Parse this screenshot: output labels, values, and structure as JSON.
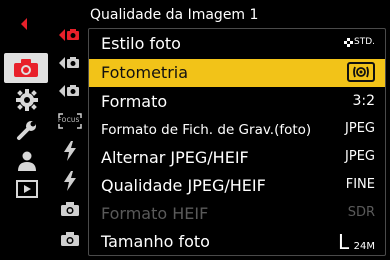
{
  "header": {
    "title": "Qualidade da Imagem 1"
  },
  "categories": [
    {
      "icon": "tab-marker-icon"
    },
    {
      "icon": "camera-icon",
      "active": true
    },
    {
      "icon": "gear-icon"
    },
    {
      "icon": "wrench-icon"
    },
    {
      "icon": "person-icon"
    },
    {
      "icon": "playback-icon"
    }
  ],
  "tabs": [
    {
      "icon": "photo-tab-1-icon",
      "active": true
    },
    {
      "icon": "photo-tab-2-icon"
    },
    {
      "icon": "photo-tab-3-icon"
    },
    {
      "icon": "focus-tab-icon",
      "text": "FOCUS"
    },
    {
      "icon": "flash-tab-icon"
    },
    {
      "icon": "flash-tab-2-icon"
    },
    {
      "icon": "camera-tab-icon"
    },
    {
      "icon": "camera-tab-2-icon"
    }
  ],
  "menu": {
    "items": [
      {
        "label": "Estilo foto",
        "value": "STD."
      },
      {
        "label": "Fotometria",
        "value": "metering-icon"
      },
      {
        "label": "Formato",
        "value": "3:2"
      },
      {
        "label": "Formato de Fich. de Grav.(foto)",
        "value": "JPEG"
      },
      {
        "label": "Alternar JPEG/HEIF",
        "value": "JPEG"
      },
      {
        "label": "Qualidade JPEG/HEIF",
        "value": "FINE"
      },
      {
        "label": "Formato HEIF",
        "value": "SDR"
      },
      {
        "label": "Tamanho foto",
        "value_size": "L",
        "value_res": "24M"
      }
    ]
  },
  "colors": {
    "selection": "#f2c318",
    "accent": "#e8202a",
    "disabled": "#5a5a5a"
  }
}
